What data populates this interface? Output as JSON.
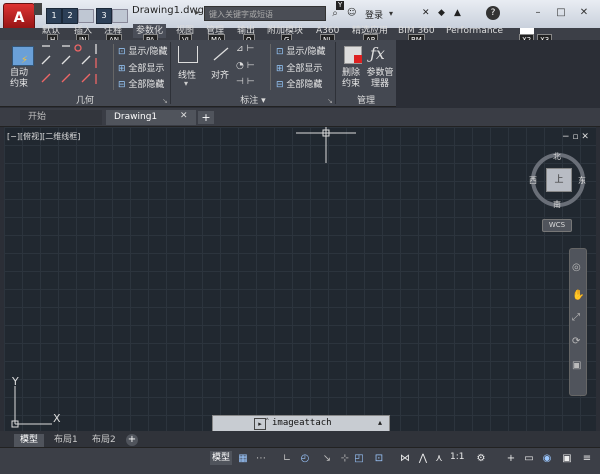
{
  "title_bar": {
    "app_button": "A",
    "quick_access_keytips": [
      "1",
      "2",
      "3"
    ],
    "doc_title": "Drawing1.dwg",
    "search_placeholder": "键入关键字或短语",
    "login": "登录",
    "login_keytip": "Y",
    "help": "?"
  },
  "ribbon_tabs": [
    {
      "label": "默认",
      "keytip": "H",
      "active": false
    },
    {
      "label": "插入",
      "keytip": "IN",
      "active": false
    },
    {
      "label": "注释",
      "keytip": "AN",
      "active": false
    },
    {
      "label": "参数化",
      "keytip": "PA",
      "active": true
    },
    {
      "label": "视图",
      "keytip": "VI",
      "active": false
    },
    {
      "label": "管理",
      "keytip": "MA",
      "active": false
    },
    {
      "label": "输出",
      "keytip": "O",
      "active": false
    },
    {
      "label": "附加模块",
      "keytip": "G",
      "active": false
    },
    {
      "label": "A360",
      "keytip": "NL",
      "active": false
    },
    {
      "label": "精选应用",
      "keytip": "AP",
      "active": false
    },
    {
      "label": "BIM 360",
      "keytip": "BM",
      "active": false
    },
    {
      "label": "Performance",
      "keytip": "",
      "active": false
    }
  ],
  "extra_keytips": [
    "X2",
    "X3"
  ],
  "ribbon": {
    "auto_constrain": "自动约束",
    "geo_show_hide": "显示/隐藏",
    "geo_show_all": "全部显示",
    "geo_hide_all": "全部隐藏",
    "panel_geometric": "几何",
    "linear": "线性",
    "aligned": "对齐",
    "dim_show_hide": "显示/隐藏",
    "dim_show_all": "全部显示",
    "dim_hide_all": "全部隐藏",
    "panel_dimension": "标注",
    "delete_constraints": "删除约束",
    "param_manager": "参数管理器",
    "panel_manage": "管理"
  },
  "doc_tabs": [
    {
      "label": "开始",
      "active": false
    },
    {
      "label": "Drawing1",
      "active": true
    }
  ],
  "viewport_label": "[−][俯视][二维线框]",
  "viewcube": {
    "north": "北",
    "south": "南",
    "east": "东",
    "west": "西",
    "face": "上",
    "wcs": "WCS"
  },
  "ucs": {
    "x": "X",
    "y": "Y"
  },
  "command": {
    "value": "imageattach"
  },
  "layout_tabs": [
    {
      "label": "模型",
      "active": true
    },
    {
      "label": "布局1",
      "active": false
    },
    {
      "label": "布局2",
      "active": false
    }
  ],
  "status": {
    "model": "模型",
    "scale": "1:1"
  }
}
